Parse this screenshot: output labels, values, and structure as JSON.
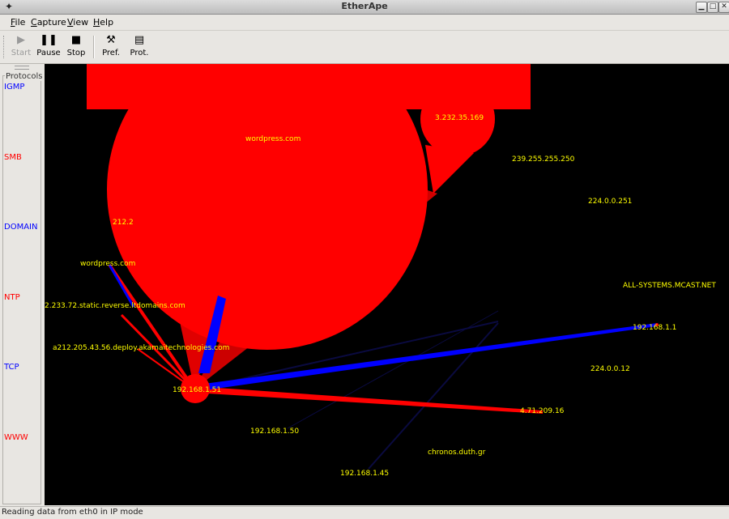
{
  "window": {
    "title": "EtherApe"
  },
  "menu": {
    "items": [
      {
        "label": "File",
        "u": "F",
        "rest": "ile"
      },
      {
        "label": "Capture",
        "u": "C",
        "rest": "apture"
      },
      {
        "label": "View",
        "u": "V",
        "rest": "iew"
      },
      {
        "label": "Help",
        "u": "H",
        "rest": "elp"
      }
    ]
  },
  "toolbar": {
    "start": "Start",
    "pause": "Pause",
    "stop": "Stop",
    "pref": "Pref.",
    "prot": "Prot."
  },
  "protocols": {
    "title": "Protocols",
    "items": [
      {
        "name": "IGMP",
        "color": "#0000ff"
      },
      {
        "name": "SMB",
        "color": "#ff0000"
      },
      {
        "name": "DOMAIN",
        "color": "#0000ff"
      },
      {
        "name": "NTP",
        "color": "#ff0000"
      },
      {
        "name": "TCP",
        "color": "#0000ff"
      },
      {
        "name": "WWW",
        "color": "#ff0000"
      }
    ]
  },
  "nodes": {
    "wordpress_big": "wordpress.com",
    "ip_232": "3.232.35.169",
    "mcast_250": "239.255.255.250",
    "mcast_251": "224.0.0.251",
    "ip_212": "212.2",
    "wordpress_small": "wordpress.com",
    "all_systems": "ALL-SYSTEMS.MCAST.NET",
    "ltdomains": "2.233.72.static.reverse.ltdomains.com",
    "gateway": "192.168.1.1",
    "akamai": "a212.205.43.56.deploy.akamaitechnologies.com",
    "mcast_12": "224.0.0.12",
    "local_51": "192.168.1.51",
    "ip_471": "4.71.209.16",
    "local_50": "192.168.1.50",
    "chronos": "chronos.duth.gr",
    "local_45": "192.168.1.45"
  },
  "colors": {
    "www": "#ff0000",
    "tcp": "#0000ff",
    "label": "#ffff00",
    "background": "#000000"
  },
  "status": {
    "text": "Reading data from eth0 in IP mode"
  }
}
